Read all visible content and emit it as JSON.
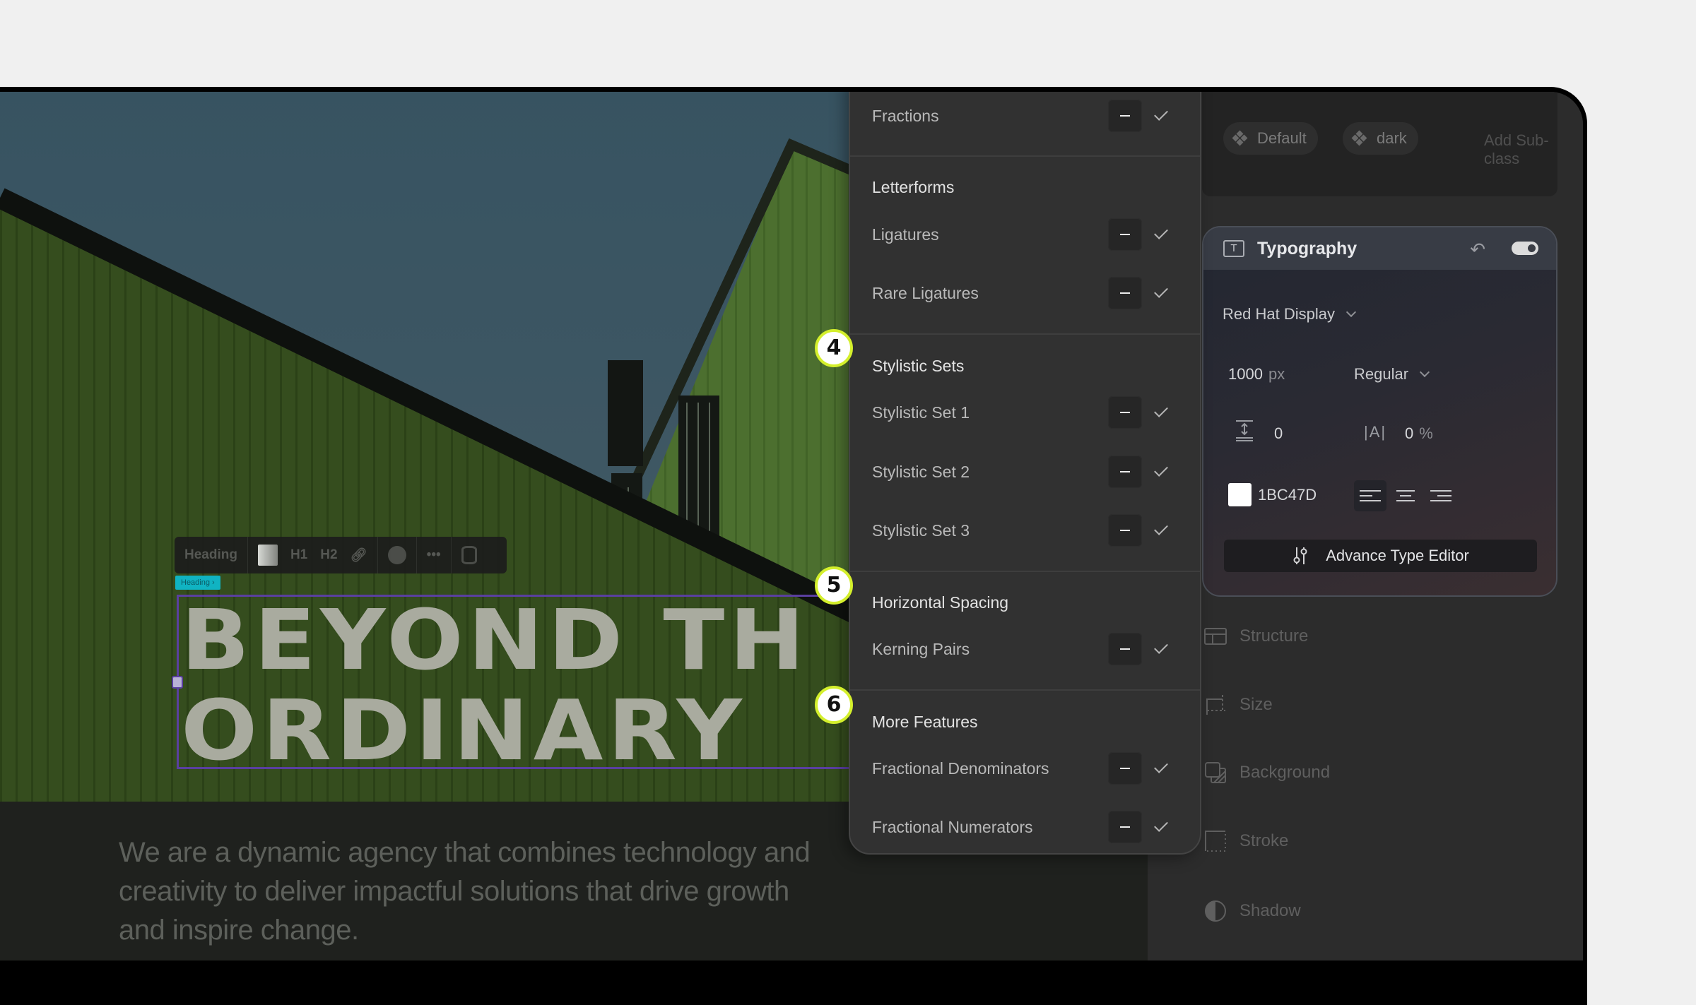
{
  "canvas": {
    "element_toolbar": {
      "element_type": "Heading",
      "h1_label": "H1",
      "h2_label": "H2",
      "more_label": "•••"
    },
    "selection_tag": "Heading ›",
    "hero_heading": "BEYOND TH\nORDINARY",
    "body_copy": "We are a dynamic agency that combines technology and creativity to deliver impactful solutions that drive growth and inspire change."
  },
  "font_features_dropdown": {
    "groups": [
      {
        "title": null,
        "items": [
          {
            "label": "Fractions",
            "minus": "−",
            "enabled": true
          }
        ]
      },
      {
        "title": "Letterforms",
        "items": [
          {
            "label": "Ligatures",
            "enabled": true
          },
          {
            "label": "Rare Ligatures",
            "enabled": true
          }
        ]
      },
      {
        "title": "Stylistic Sets",
        "badge": "4",
        "items": [
          {
            "label": "Stylistic Set 1",
            "enabled": true
          },
          {
            "label": "Stylistic Set 2",
            "enabled": true
          },
          {
            "label": "Stylistic Set 3",
            "enabled": true
          }
        ]
      },
      {
        "title": "Horizontal Spacing",
        "badge": "5",
        "items": [
          {
            "label": "Kerning Pairs",
            "enabled": true
          }
        ]
      },
      {
        "title": "More Features",
        "badge": "6",
        "items": [
          {
            "label": "Fractional Denominators",
            "enabled": true
          },
          {
            "label": "Fractional Numerators",
            "enabled": true
          }
        ]
      }
    ]
  },
  "right_panel": {
    "subclasses": {
      "chips": [
        "Default",
        "dark"
      ],
      "add_label": "Add Sub-class"
    },
    "typography": {
      "title": "Typography",
      "icon_letter": "T",
      "enabled": true,
      "font_family": "Red Hat Display",
      "font_size": "1000",
      "font_size_unit": "px",
      "font_weight": "Regular",
      "line_height": "0",
      "letter_spacing_icon": "|A|",
      "letter_spacing": "0",
      "letter_spacing_unit": "%",
      "color_hex": "1BC47D",
      "color_swatch": "#FFFFFF",
      "alignment_options": [
        "left",
        "center",
        "right"
      ],
      "alignment_selected": "left",
      "advanced_button": "Advance Type Editor"
    },
    "sections": [
      "Structure",
      "Size",
      "Background",
      "Stroke",
      "Shadow"
    ]
  },
  "colors": {
    "badge_ring": "#D4EF2C",
    "selection_outline": "#5A3FA0",
    "selection_tag": "#10B3C2"
  }
}
